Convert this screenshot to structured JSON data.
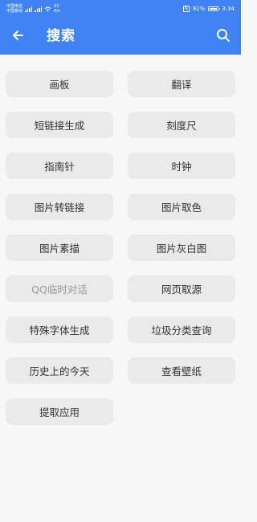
{
  "status_bar": {
    "carrier_1": "中国电信",
    "carrier_2": "中国移动",
    "network_speed": "93",
    "network_unit": "B/s",
    "nfc": "N",
    "battery_text": "92%",
    "battery_level": 0.92,
    "time": "3:34"
  },
  "app_bar": {
    "title": "搜索",
    "back_icon": "arrow-left-icon",
    "search_icon": "search-icon"
  },
  "colors": {
    "primary": "#3f83f4",
    "button_bg": "#eaeaea",
    "page_bg": "#f7f7f7"
  },
  "tools": [
    {
      "name": "huaban",
      "label": "画板"
    },
    {
      "name": "fanyi",
      "label": "翻译"
    },
    {
      "name": "duanlianjie",
      "label": "短链接生成"
    },
    {
      "name": "keduchi",
      "label": "刻度尺"
    },
    {
      "name": "zhinanzhen",
      "label": "指南针"
    },
    {
      "name": "shizhong",
      "label": "时钟"
    },
    {
      "name": "tupian-zhuan-lianjie",
      "label": "图片转链接"
    },
    {
      "name": "tupian-quse",
      "label": "图片取色"
    },
    {
      "name": "tupian-sumiao",
      "label": "图片素描"
    },
    {
      "name": "tupian-huibaitu",
      "label": "图片灰白图"
    },
    {
      "name": "qq-linshi-duihua",
      "label": "QQ临时对话",
      "faded": true
    },
    {
      "name": "wangye-quyuan",
      "label": "网页取源"
    },
    {
      "name": "teshu-ziti",
      "label": "特殊字体生成"
    },
    {
      "name": "laji-fenlei",
      "label": "垃圾分类查询"
    },
    {
      "name": "lishi-jintian",
      "label": "历史上的今天"
    },
    {
      "name": "chakan-bizhi",
      "label": "查看壁纸"
    },
    {
      "name": "tiqu-yingyong",
      "label": "提取应用"
    }
  ]
}
